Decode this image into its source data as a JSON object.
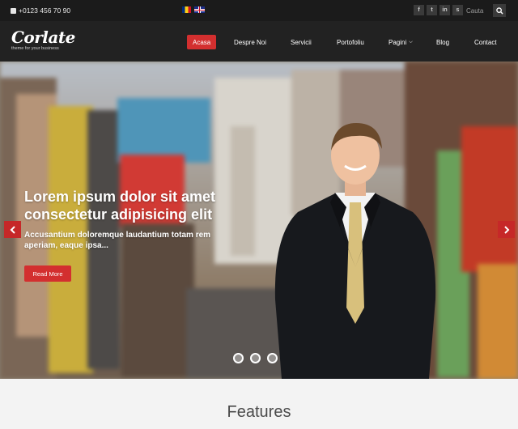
{
  "topbar": {
    "phone": "+0123 456 70 90",
    "languages": [
      {
        "code": "ro",
        "icon": "romania-flag-icon"
      },
      {
        "code": "en",
        "icon": "uk-flag-icon"
      }
    ],
    "socials": [
      {
        "icon": "facebook-icon",
        "glyph": "f"
      },
      {
        "icon": "twitter-icon",
        "glyph": "t"
      },
      {
        "icon": "linkedin-icon",
        "glyph": "in"
      },
      {
        "icon": "skype-icon",
        "glyph": "s"
      }
    ],
    "search_placeholder": "Cauta"
  },
  "header": {
    "logo": "Corlate",
    "tagline": "theme for your business",
    "nav": [
      {
        "label": "Acasa",
        "active": true
      },
      {
        "label": "Despre Noi"
      },
      {
        "label": "Servicii"
      },
      {
        "label": "Portofoliu"
      },
      {
        "label": "Pagini",
        "dropdown": true
      },
      {
        "label": "Blog"
      },
      {
        "label": "Contact"
      }
    ]
  },
  "hero": {
    "title": "Lorem ipsum dolor sit amet consectetur adipisicing elit",
    "subtitle": "Accusantium doloremque laudantium totam rem aperiam, eaque ipsa...",
    "button": "Read More",
    "slides": 3,
    "active_slide": 1
  },
  "features": {
    "title": "Features"
  },
  "colors": {
    "accent": "#d32f2f",
    "topbar": "#1b1b1b",
    "header": "#222222"
  }
}
